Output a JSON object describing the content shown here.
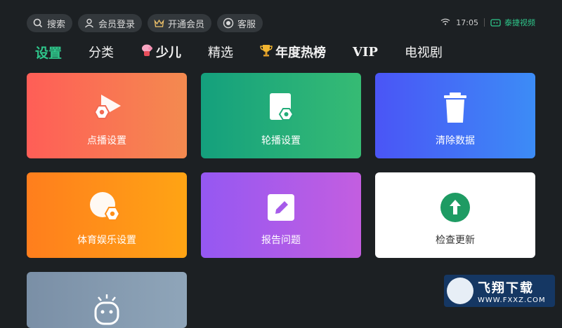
{
  "topbar": {
    "search": "搜索",
    "login": "会员登录",
    "vip_open": "开通会员",
    "service": "客服"
  },
  "status": {
    "time": "17:05",
    "brand": "泰捷视频"
  },
  "nav": {
    "items": [
      "设置",
      "分类",
      "少儿",
      "精选",
      "年度热榜",
      "VIP",
      "电视剧"
    ],
    "active_color": "#2ec58a"
  },
  "tiles": [
    {
      "label": "点播设置",
      "icon": "play-gear-icon"
    },
    {
      "label": "轮播设置",
      "icon": "file-gear-icon"
    },
    {
      "label": "清除数据",
      "icon": "trash-icon"
    },
    {
      "label": "体育娱乐设置",
      "icon": "ball-gear-icon"
    },
    {
      "label": "报告问题",
      "icon": "edit-icon"
    },
    {
      "label": "检查更新",
      "icon": "up-arrow-icon"
    },
    {
      "label": "",
      "icon": "robot-icon"
    }
  ],
  "watermark": {
    "title": "飞翔下载",
    "url": "WWW.FXXZ.COM"
  }
}
